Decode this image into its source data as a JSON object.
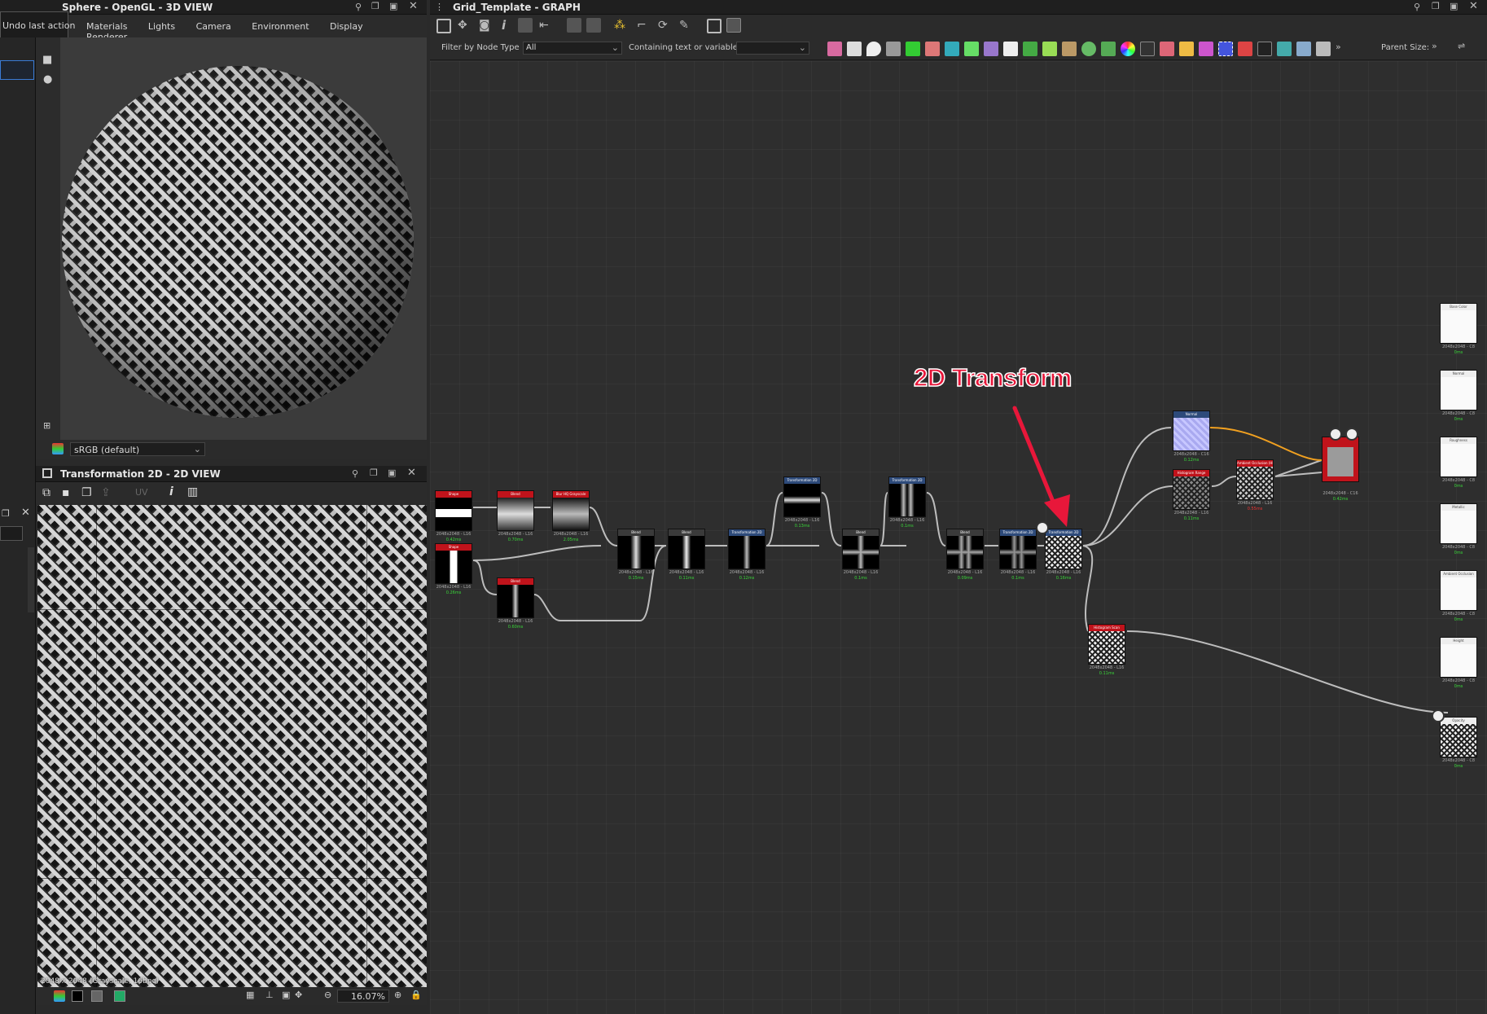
{
  "view3d": {
    "title": "Sphere - OpenGL - 3D VIEW",
    "tooltip": "Undo last action",
    "menu": [
      "Materials",
      "Lights",
      "Camera",
      "Environment",
      "Display",
      "Renderer"
    ],
    "colorspace": "sRGB (default)"
  },
  "view2d": {
    "title": "Transformation 2D - 2D VIEW",
    "uv_label": "UV",
    "status_text": "2048 x 2048 (Grayscale, 16bpc)",
    "zoom": "16.07%"
  },
  "graph": {
    "title": "Grid_Template - GRAPH",
    "filter_label": "Filter by Node Type",
    "filter_value": "All",
    "contain_label": "Containing text or variable",
    "contain_value": "",
    "parent_size_label": "Parent Size:",
    "annotation": "2D Transform"
  },
  "nodes": [
    {
      "id": "n1",
      "title": "Shape",
      "size": "2048x2048 - L16",
      "time": "0.42ms",
      "header": "#c0131b"
    },
    {
      "id": "n2",
      "title": "Blend",
      "size": "2048x2048 - L16",
      "time": "0.70ms",
      "header": "#c0131b"
    },
    {
      "id": "n3",
      "title": "Blur HQ Grayscale",
      "size": "2048x2048 - L16",
      "time": "2.05ms",
      "header": "#c0131b"
    },
    {
      "id": "n4",
      "title": "Shape",
      "size": "2048x2048 - L16",
      "time": "0.26ms",
      "header": "#c0131b"
    },
    {
      "id": "n5",
      "title": "Blend",
      "size": "2048x2048 - L16",
      "time": "0.60ms",
      "header": "#c0131b"
    },
    {
      "id": "n6",
      "title": "Blend",
      "size": "2048x2048 - L16",
      "time": "0.15ms",
      "header": "#3a3a3a"
    },
    {
      "id": "n7",
      "title": "Blend",
      "size": "2048x2048 - L16",
      "time": "0.11ms",
      "header": "#3a3a3a"
    },
    {
      "id": "n8",
      "title": "Transformation 2D",
      "size": "2048x2048 - L16",
      "time": "0.12ms",
      "header": "#2d4a7a"
    },
    {
      "id": "n9",
      "title": "Transformation 2D",
      "size": "2048x2048 - L16",
      "time": "0.13ms",
      "header": "#2d4a7a"
    },
    {
      "id": "n10",
      "title": "Blend",
      "size": "2048x2048 - L16",
      "time": "0.1ms",
      "header": "#3a3a3a"
    },
    {
      "id": "n11",
      "title": "Transformation 2D",
      "size": "2048x2048 - L16",
      "time": "0.1ms",
      "header": "#2d4a7a"
    },
    {
      "id": "n12",
      "title": "Blend",
      "size": "2048x2048 - L16",
      "time": "0.09ms",
      "header": "#3a3a3a"
    },
    {
      "id": "n13",
      "title": "Transformation 2D",
      "size": "2048x2048 - L16",
      "time": "0.1ms",
      "header": "#2d4a7a"
    },
    {
      "id": "n14",
      "title": "Transformation 2D",
      "size": "2048x2048 - L16",
      "time": "0.16ms",
      "header": "#2d4a7a"
    },
    {
      "id": "n15",
      "title": "Normal",
      "size": "2048x2048 - C16",
      "time": "0.12ms",
      "header": "#2d4a7a"
    },
    {
      "id": "n16",
      "title": "Histogram Range",
      "size": "2048x2048 - L16",
      "time": "0.11ms",
      "header": "#c0131b"
    },
    {
      "id": "n17",
      "title": "Ambient Occlusion (HBAO)",
      "size": "2048x2048 - L16",
      "time": "0.55ms",
      "header": "#c0131b"
    },
    {
      "id": "n18",
      "title": "",
      "size": "2048x2048 - C16",
      "time": "0.42ms",
      "header": "#c0131b"
    },
    {
      "id": "n19",
      "title": "Histogram Scan",
      "size": "2048x2048 - L16",
      "time": "0.11ms",
      "header": "#c0131b"
    }
  ],
  "outputs": [
    {
      "title": "Base Color",
      "size": "2048x2048 - C8",
      "time": "0ms"
    },
    {
      "title": "Normal",
      "size": "2048x2048 - C8",
      "time": "0ms"
    },
    {
      "title": "Roughness",
      "size": "2048x2048 - C8",
      "time": "0ms"
    },
    {
      "title": "Metallic",
      "size": "2048x2048 - C8",
      "time": "0ms"
    },
    {
      "title": "Ambient Occlusion",
      "size": "2048x2048 - C8",
      "time": "0ms"
    },
    {
      "title": "Height",
      "size": "2048x2048 - C8",
      "time": "0ms"
    },
    {
      "title": "Opacity",
      "size": "2048x2048 - C8",
      "time": "0ms"
    }
  ],
  "colors": {
    "accent_red": "#e8173a",
    "green_time": "#39d639",
    "wire": "#bdbdbd",
    "wire_orange": "#f0a020"
  }
}
